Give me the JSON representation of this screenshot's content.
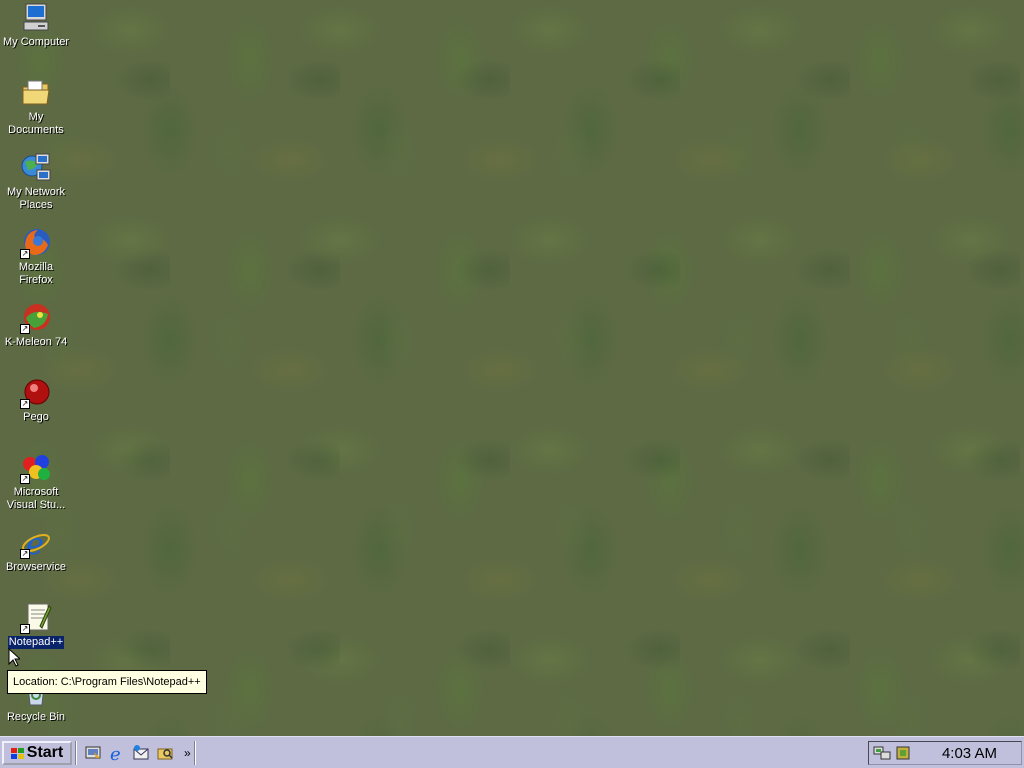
{
  "desktop": {
    "icons": [
      {
        "label": "My Computer",
        "icon": "my-computer-icon"
      },
      {
        "label": "My Documents",
        "icon": "my-documents-icon"
      },
      {
        "label_line1": "My Network",
        "label_line2": "Places",
        "icon": "my-network-places-icon"
      },
      {
        "label": "Mozilla Firefox",
        "icon": "firefox-icon"
      },
      {
        "label": "K-Meleon 74",
        "icon": "k-meleon-icon"
      },
      {
        "label": "Pego",
        "icon": "pego-icon"
      },
      {
        "label_line1": "Microsoft",
        "label_line2": "Visual Stu...",
        "icon": "visual-studio-icon"
      },
      {
        "label": "Browservice",
        "icon": "internet-explorer-icon"
      },
      {
        "label": "Notepad++",
        "icon": "notepad-plus-plus-icon"
      },
      {
        "label": "Recycle Bin",
        "icon": "recycle-bin-icon"
      }
    ],
    "tooltip": "Location: C:\\Program Files\\Notepad++"
  },
  "taskbar": {
    "start_label": "Start",
    "quick_launch": [
      "show-desktop-icon",
      "internet-explorer-icon",
      "outlook-express-icon",
      "explorer-icon"
    ],
    "chevron": "»",
    "clock": "4:03 AM",
    "tray_icons": [
      "network-icon",
      "volume-icon"
    ]
  },
  "colors": {
    "desktop_bg": "#5d6a44",
    "taskbar_bg": "#c0c0dc",
    "tooltip_bg": "#ffffe1"
  }
}
